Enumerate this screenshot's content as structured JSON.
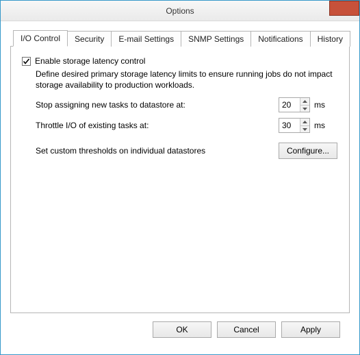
{
  "window": {
    "title": "Options"
  },
  "tabs": [
    {
      "label": "I/O Control"
    },
    {
      "label": "Security"
    },
    {
      "label": "E-mail Settings"
    },
    {
      "label": "SNMP Settings"
    },
    {
      "label": "Notifications"
    },
    {
      "label": "History"
    }
  ],
  "io": {
    "enable_label": "Enable storage latency control",
    "enable_checked": true,
    "description": "Define desired primary storage latency limits to ensure running jobs do not impact storage availability to production workloads.",
    "stop_label": "Stop assigning new tasks to datastore at:",
    "stop_value": "20",
    "throttle_label": "Throttle I/O of existing tasks at:",
    "throttle_value": "30",
    "unit": "ms",
    "custom_label": "Set custom thresholds on individual datastores",
    "configure_label": "Configure..."
  },
  "buttons": {
    "ok": "OK",
    "cancel": "Cancel",
    "apply": "Apply"
  }
}
